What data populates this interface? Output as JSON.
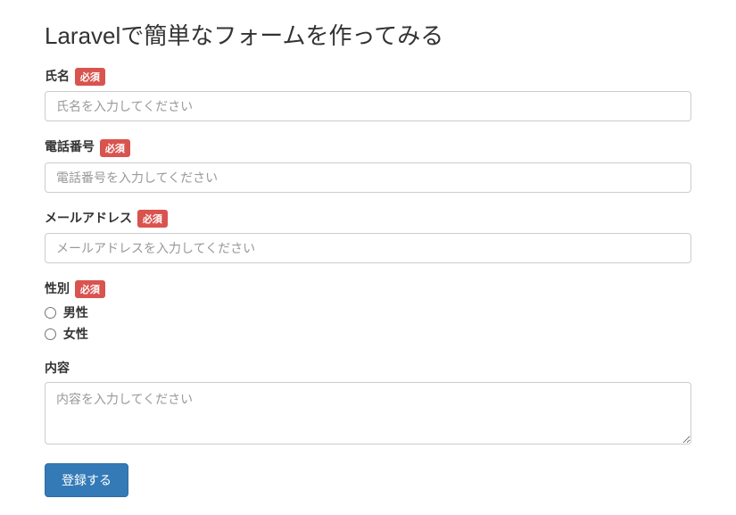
{
  "title": "Laravelで簡単なフォームを作ってみる",
  "required_badge": "必須",
  "fields": {
    "name": {
      "label": "氏名",
      "placeholder": "氏名を入力してください",
      "required": true
    },
    "phone": {
      "label": "電話番号",
      "placeholder": "電話番号を入力してください",
      "required": true
    },
    "email": {
      "label": "メールアドレス",
      "placeholder": "メールアドレスを入力してください",
      "required": true
    },
    "gender": {
      "label": "性別",
      "required": true,
      "options": [
        {
          "label": "男性"
        },
        {
          "label": "女性"
        }
      ]
    },
    "content": {
      "label": "内容",
      "placeholder": "内容を入力してください",
      "required": false
    }
  },
  "submit_label": "登録する"
}
